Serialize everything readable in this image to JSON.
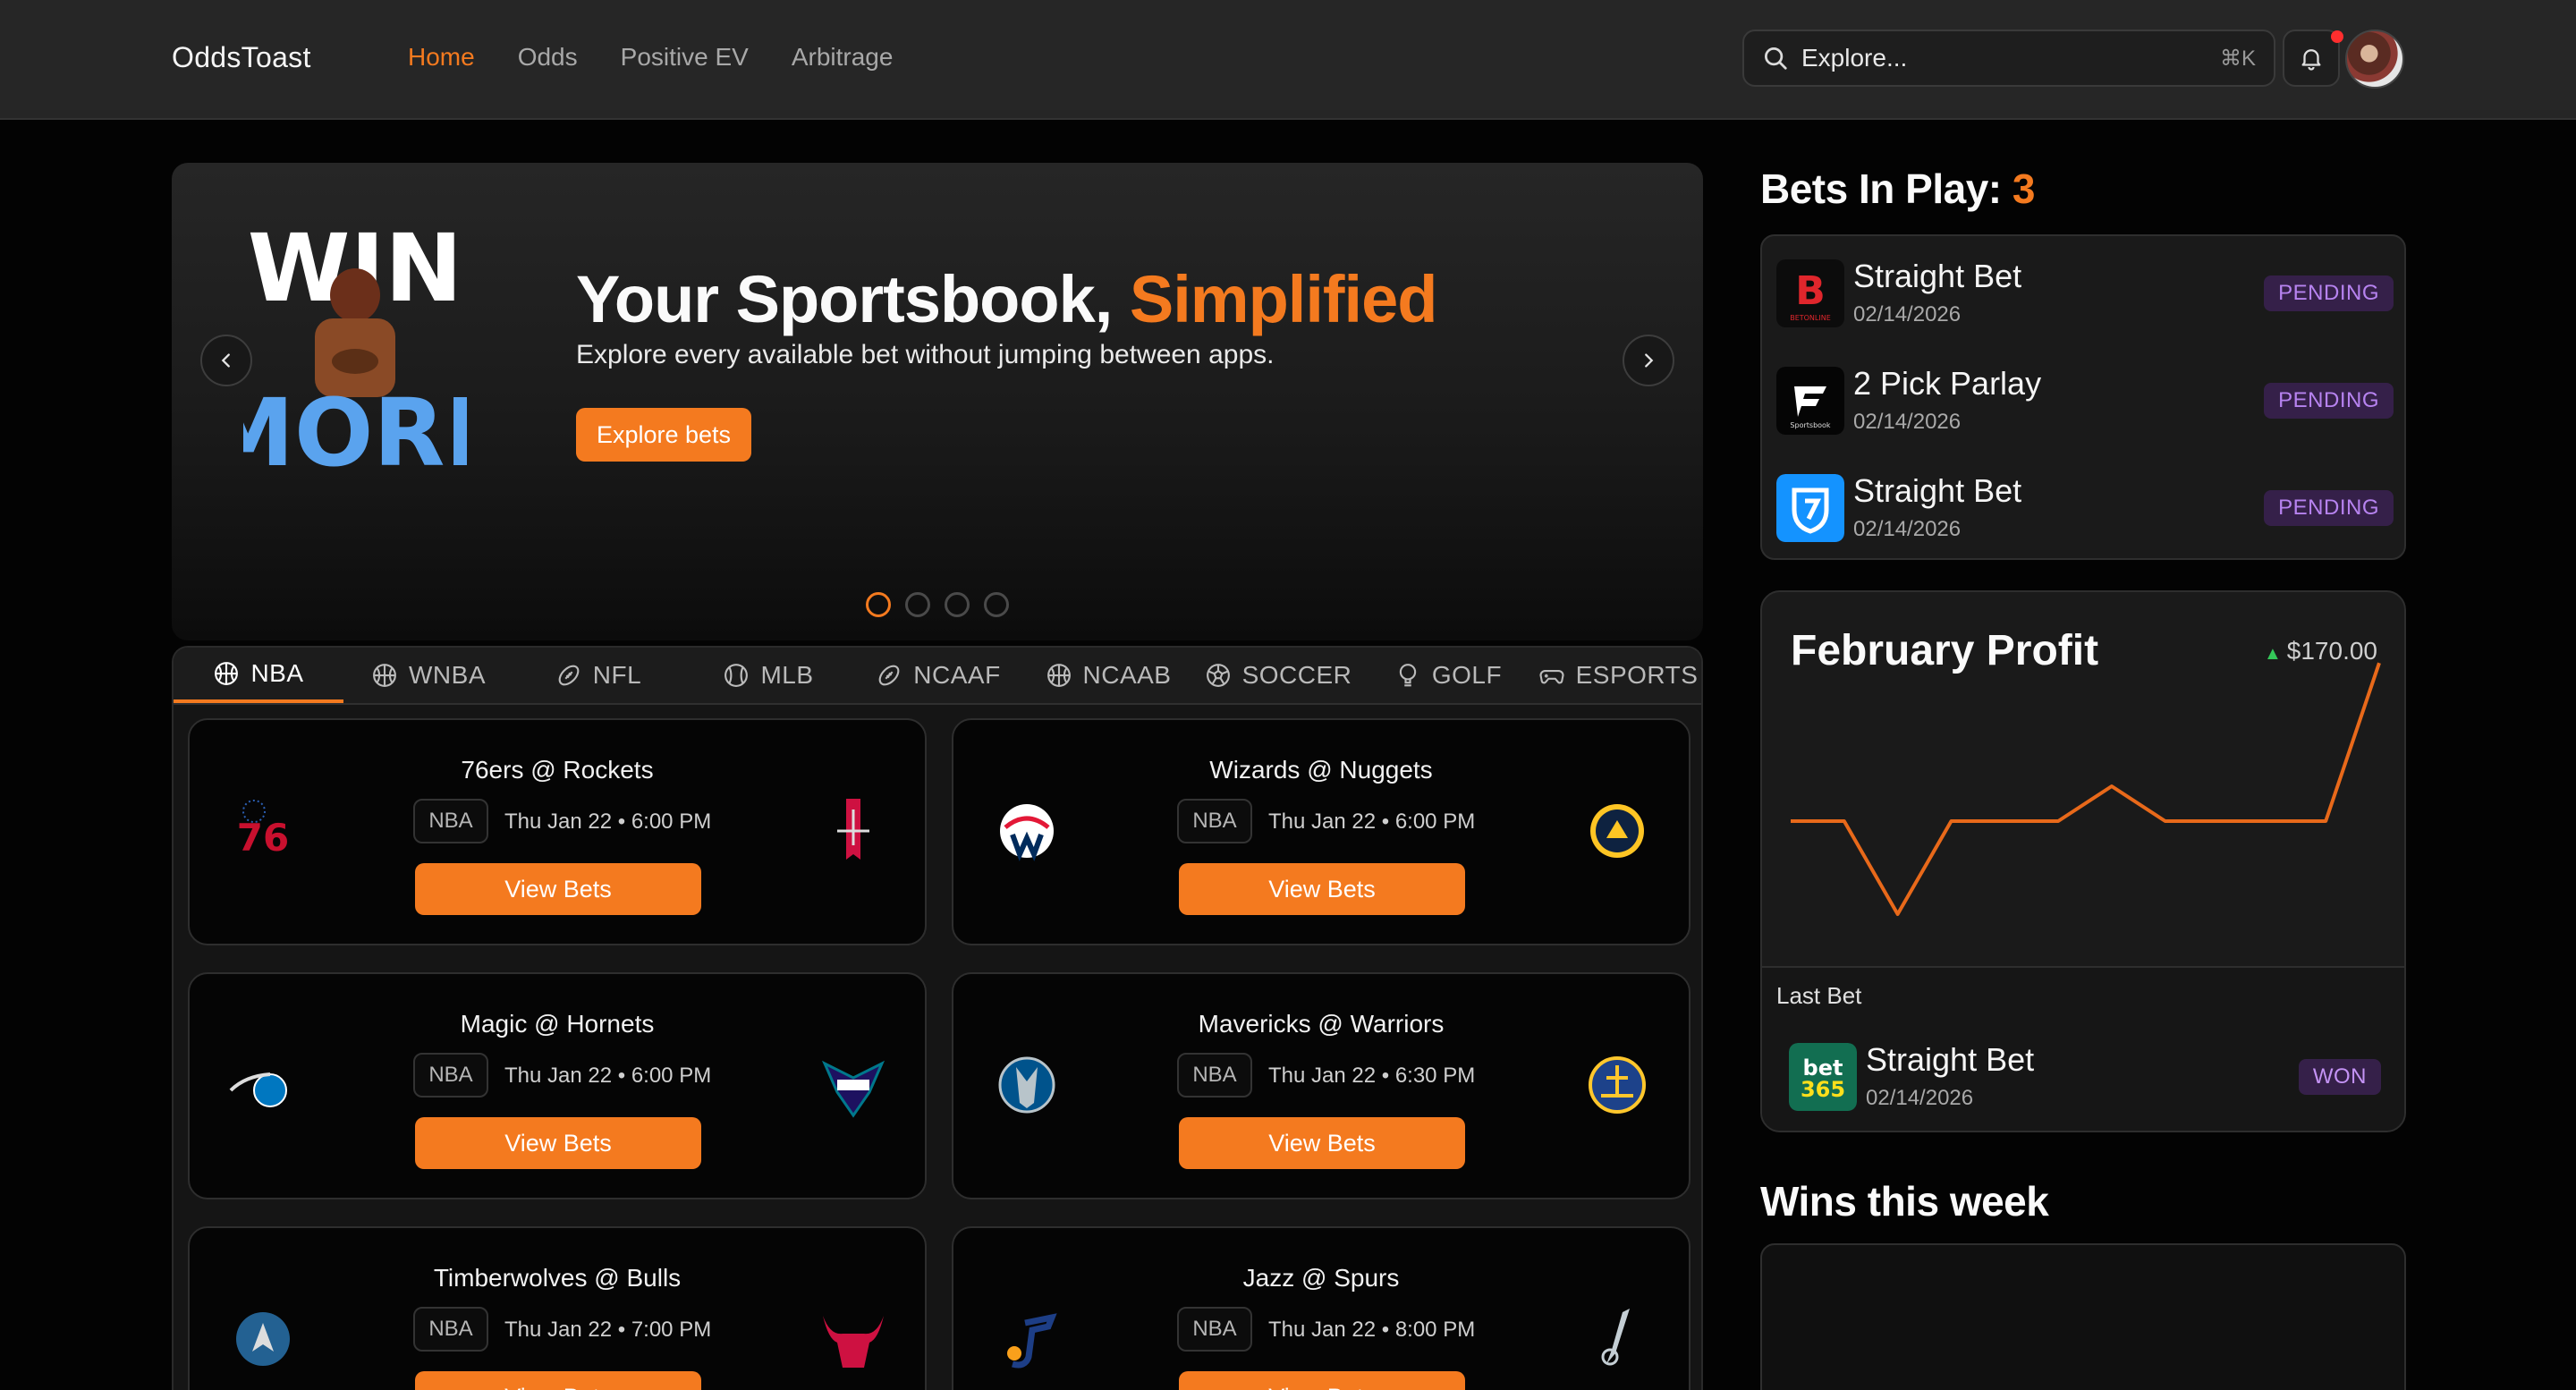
{
  "header": {
    "brand": "OddsToast",
    "nav": [
      "Home",
      "Odds",
      "Positive EV",
      "Arbitrage"
    ],
    "active_nav": "Home",
    "search": {
      "placeholder": "Explore...",
      "shortcut": "⌘K"
    },
    "notification_dot": true
  },
  "hero": {
    "promo": {
      "line1": "WIN",
      "line2": "MORE"
    },
    "title_main": "Your Sportsbook, ",
    "title_accent": "Simplified",
    "subtitle": "Explore every available bet without jumping between apps.",
    "cta": "Explore bets",
    "slides": 4,
    "active_slide": 1
  },
  "leagues": {
    "tabs": [
      "NBA",
      "WNBA",
      "NFL",
      "MLB",
      "NCAAF",
      "NCAAB",
      "SOCCER",
      "GOLF",
      "ESPORTS"
    ],
    "active": "NBA"
  },
  "games": [
    {
      "matchup": "76ers @ Rockets",
      "league": "NBA",
      "time": "Thu Jan 22 • 6:00 PM",
      "cta": "View Bets",
      "away": "76ers",
      "home": "Rockets"
    },
    {
      "matchup": "Wizards @ Nuggets",
      "league": "NBA",
      "time": "Thu Jan 22 • 6:00 PM",
      "cta": "View Bets",
      "away": "Wizards",
      "home": "Nuggets"
    },
    {
      "matchup": "Magic @ Hornets",
      "league": "NBA",
      "time": "Thu Jan 22 • 6:00 PM",
      "cta": "View Bets",
      "away": "Magic",
      "home": "Hornets"
    },
    {
      "matchup": "Mavericks @ Warriors",
      "league": "NBA",
      "time": "Thu Jan 22 • 6:30 PM",
      "cta": "View Bets",
      "away": "Mavericks",
      "home": "Warriors"
    },
    {
      "matchup": "Timberwolves @ Bulls",
      "league": "NBA",
      "time": "Thu Jan 22 • 7:00 PM",
      "cta": "View Bets",
      "away": "Timberwolves",
      "home": "Bulls"
    },
    {
      "matchup": "Jazz @ Spurs",
      "league": "NBA",
      "time": "Thu Jan 22 • 8:00 PM",
      "cta": "View Bets",
      "away": "Jazz",
      "home": "Spurs"
    }
  ],
  "bets_in_play": {
    "title": "Bets In Play: ",
    "count": "3",
    "items": [
      {
        "name": "Straight Bet",
        "date": "02/14/2026",
        "status": "PENDING",
        "book_icon": "betonline-logo",
        "book_text": "BETONLINE"
      },
      {
        "name": "2 Pick Parlay",
        "date": "02/14/2026",
        "status": "PENDING",
        "book_icon": "fanatics-logo",
        "book_text": "Sportsbook"
      },
      {
        "name": "Straight Bet",
        "date": "02/14/2026",
        "status": "PENDING",
        "book_icon": "fanduel-logo"
      }
    ]
  },
  "profit": {
    "title": "February Profit",
    "value": "$170.00",
    "trend": "up",
    "series": [
      0,
      0,
      -40,
      0,
      0,
      0,
      15,
      0,
      0,
      0,
      0,
      68
    ],
    "line_color": "#e8691a"
  },
  "last_bet": {
    "label": "Last Bet",
    "name": "Straight Bet",
    "date": "02/14/2026",
    "status": "WON",
    "book_icon": "bet365-logo",
    "book_text_top": "bet",
    "book_text_bottom": "365"
  },
  "wins": {
    "title": "Wins this week"
  },
  "colors": {
    "accent": "#f47a1f",
    "pending": "#b783f0",
    "background": "#030303",
    "panel": "#1a1a1a"
  }
}
